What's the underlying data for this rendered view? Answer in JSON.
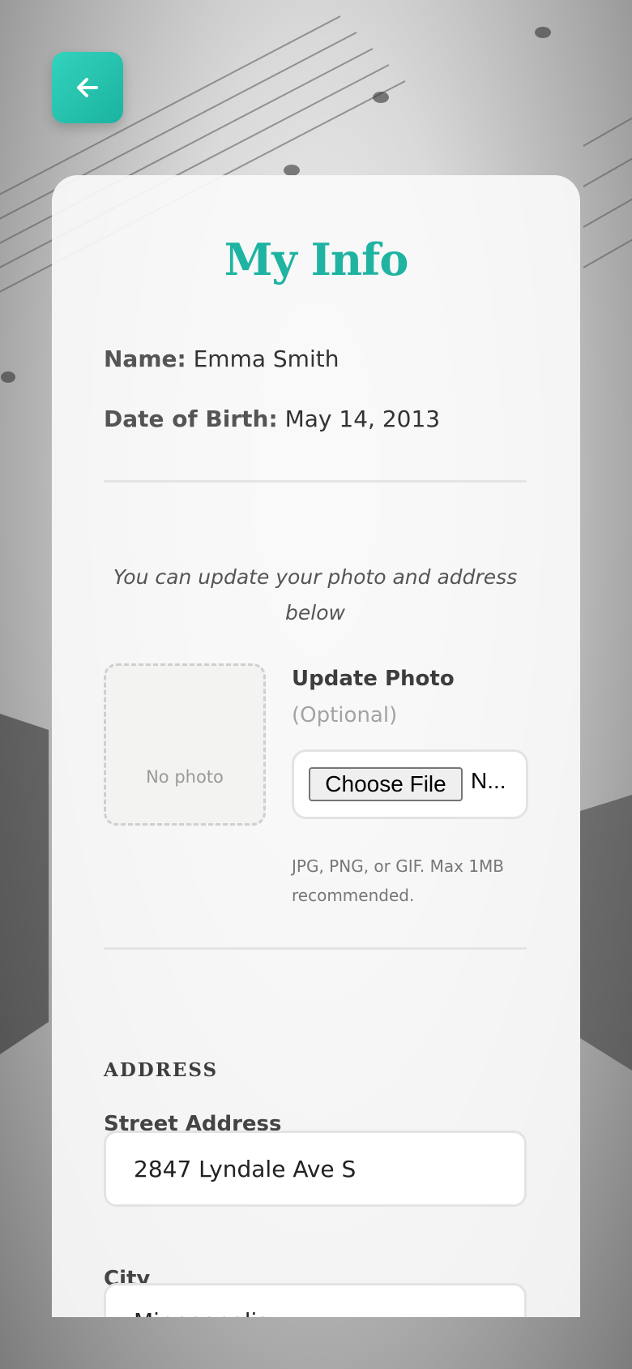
{
  "back_button": {
    "icon": "arrow-left-icon"
  },
  "header": {
    "title": "My Info"
  },
  "profile": {
    "name_label": "Name:",
    "name_value": "Emma Smith",
    "dob_label": "Date of Birth:",
    "dob_value": "May 14, 2013"
  },
  "hint_text": "You can update your photo and address below",
  "photo": {
    "placeholder": "No photo",
    "update_label": "Update Photo",
    "optional_label": "(Optional)",
    "choose_button": "Choose File",
    "no_file_text": "N...",
    "note": "JPG, PNG, or GIF. Max 1MB recommended."
  },
  "address": {
    "section_heading": "ADDRESS",
    "street_label": "Street Address",
    "street_value": "2847 Lyndale Ave S",
    "city_label": "City",
    "city_value": "Minneapolis"
  },
  "colors": {
    "accent": "#1fb3a2",
    "button_gradient_start": "#33d3bd",
    "button_gradient_end": "#1ab3a0"
  }
}
